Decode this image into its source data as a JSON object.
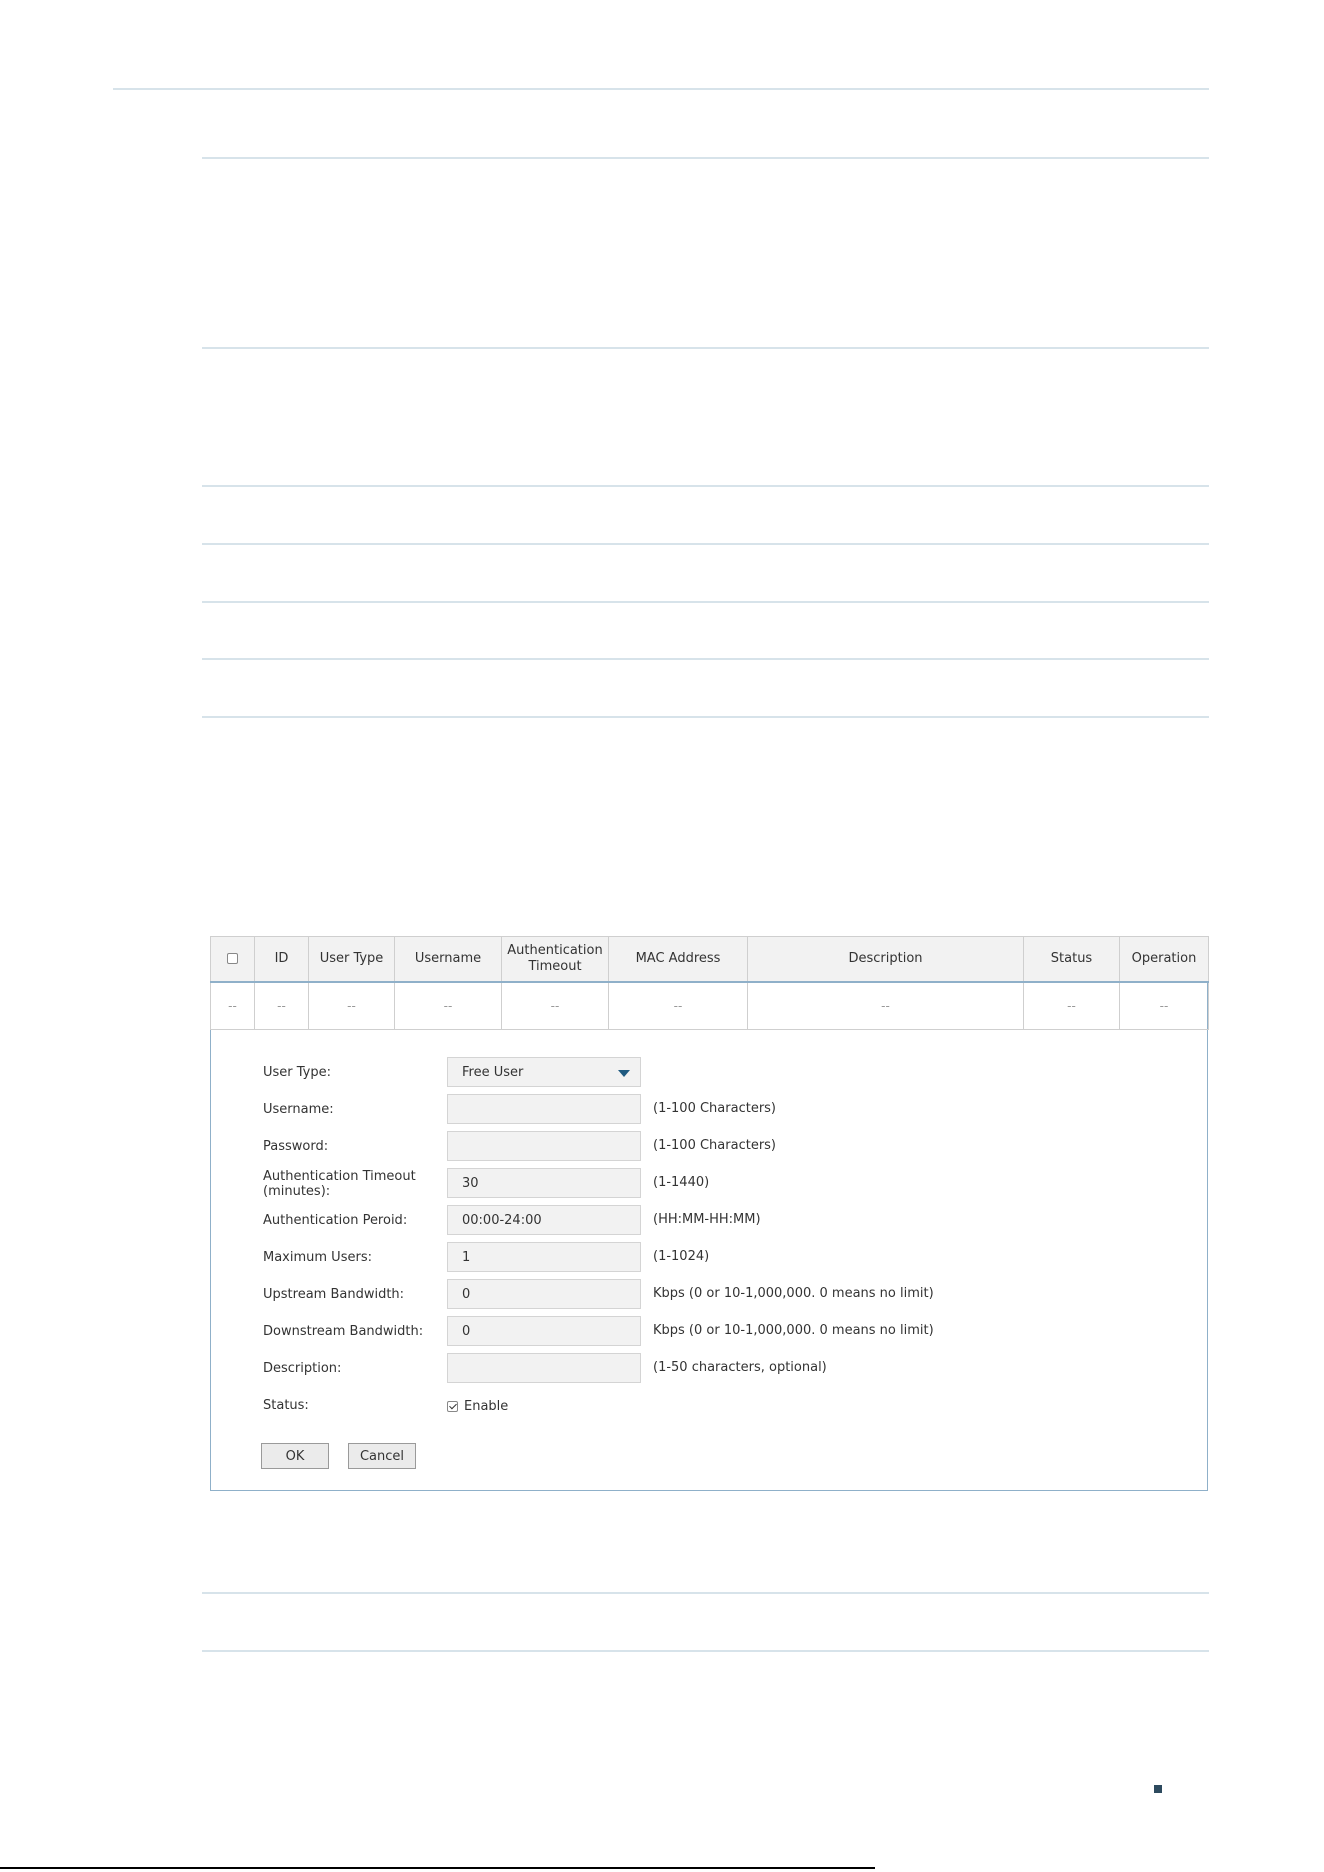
{
  "table": {
    "headers": [
      "ID",
      "User Type",
      "Username",
      "Authentication Timeout",
      "MAC Address",
      "Description",
      "Status",
      "Operation"
    ],
    "empty_row": [
      "--",
      "--",
      "--",
      "--",
      "--",
      "--",
      "--",
      "--",
      "--"
    ]
  },
  "form": {
    "user_type_label": "User Type:",
    "user_type_value": "Free User",
    "username_label": "Username:",
    "username_hint": "(1-100 Characters)",
    "password_label": "Password:",
    "password_hint": "(1-100 Characters)",
    "auth_timeout_label": "Authentication Timeout (minutes):",
    "auth_timeout_value": "30",
    "auth_timeout_hint": "(1-1440)",
    "auth_period_label": "Authentication Peroid:",
    "auth_period_value": "00:00-24:00",
    "auth_period_hint": "(HH:MM-HH:MM)",
    "max_users_label": "Maximum Users:",
    "max_users_value": "1",
    "max_users_hint": "(1-1024)",
    "upstream_label": "Upstream Bandwidth:",
    "upstream_value": "0",
    "upstream_hint": "Kbps (0 or 10-1,000,000. 0 means no limit)",
    "downstream_label": "Downstream Bandwidth:",
    "downstream_value": "0",
    "downstream_hint": "Kbps (0 or 10-1,000,000. 0 means no limit)",
    "description_label": "Description:",
    "description_hint": "(1-50 characters, optional)",
    "status_label": "Status:",
    "status_option": "Enable",
    "status_checked": true,
    "ok_label": "OK",
    "cancel_label": "Cancel"
  },
  "colors": {
    "accent": "#1f5a80",
    "panel_border": "#8fb0c9",
    "rule": "#d7e3ea",
    "field_bg": "#f2f2f2"
  }
}
